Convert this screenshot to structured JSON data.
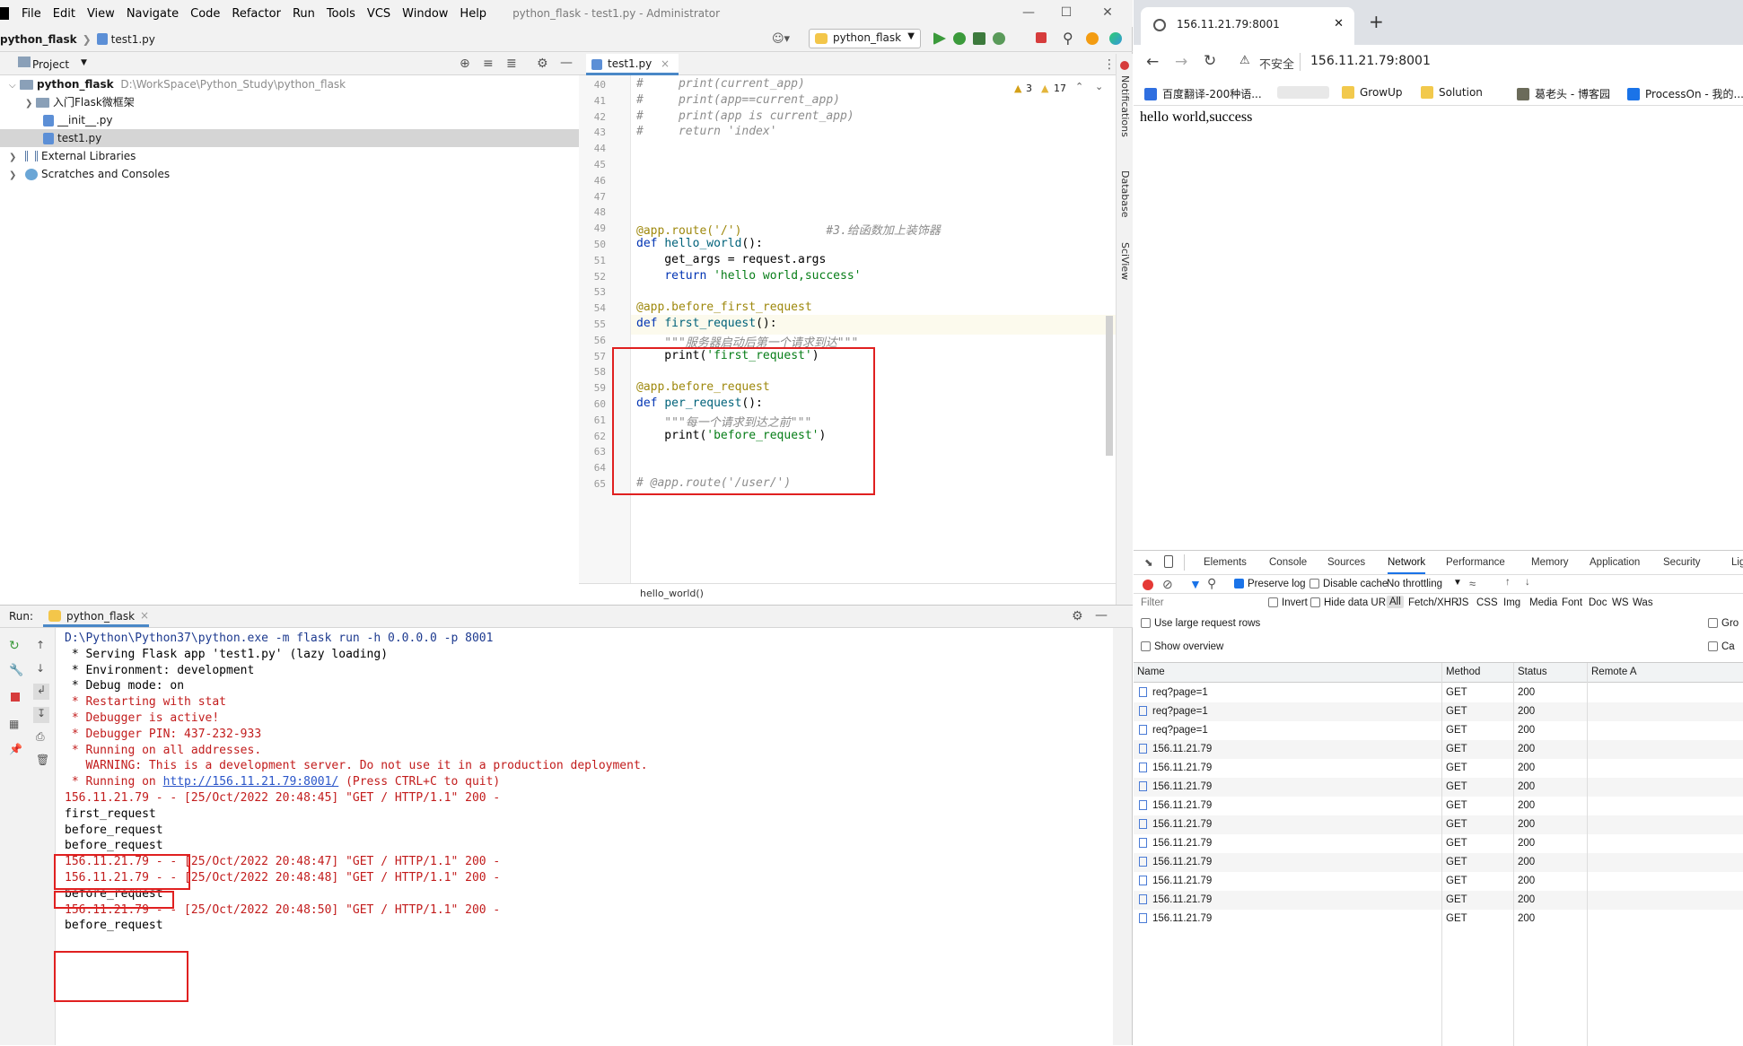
{
  "ide": {
    "menu": [
      "File",
      "Edit",
      "View",
      "Navigate",
      "Code",
      "Refactor",
      "Run",
      "Tools",
      "VCS",
      "Window",
      "Help"
    ],
    "window_title": "python_flask - test1.py - Administrator",
    "breadcrumb": {
      "project": "python_flask",
      "file": "test1.py"
    },
    "run_config": "python_flask",
    "project_panel": {
      "title": "Project",
      "root_name": "python_flask",
      "root_path": "D:\\WorkSpace\\Python_Study\\python_flask",
      "items": [
        {
          "label": "入门Flask微框架",
          "type": "folder"
        },
        {
          "label": "__init__.py",
          "type": "py"
        },
        {
          "label": "test1.py",
          "type": "py"
        },
        {
          "label": "External Libraries",
          "type": "lib"
        },
        {
          "label": "Scratches and Consoles",
          "type": "scratch"
        }
      ]
    },
    "editor": {
      "tab": "test1.py",
      "warnings": "3",
      "weak_warnings": "17",
      "lines": [
        {
          "n": "40",
          "text": "#     print(current_app)"
        },
        {
          "n": "41",
          "text": "#     print(app==current_app)"
        },
        {
          "n": "42",
          "text": "#     print(app is current_app)"
        },
        {
          "n": "43",
          "text": "#     return 'index'"
        },
        {
          "n": "44",
          "text": ""
        },
        {
          "n": "45",
          "text": ""
        },
        {
          "n": "46",
          "text": ""
        },
        {
          "n": "47",
          "text": ""
        },
        {
          "n": "48",
          "text": ""
        },
        {
          "n": "49",
          "text": "@app.route('/')",
          "comment": "#3.给函数加上装饰器"
        },
        {
          "n": "50",
          "text": "def hello_world():"
        },
        {
          "n": "51",
          "text": "    get_args = request.args"
        },
        {
          "n": "52",
          "text": "    return 'hello world,success'"
        },
        {
          "n": "53",
          "text": ""
        },
        {
          "n": "54",
          "text": "@app.before_first_request"
        },
        {
          "n": "55",
          "text": "def first_request():"
        },
        {
          "n": "56",
          "text": "    \"\"\"服务器启动后第一个请求到达\"\"\""
        },
        {
          "n": "57",
          "text": "    print('first_request')"
        },
        {
          "n": "58",
          "text": ""
        },
        {
          "n": "59",
          "text": "@app.before_request"
        },
        {
          "n": "60",
          "text": "def per_request():"
        },
        {
          "n": "61",
          "text": "    \"\"\"每一个请求到达之前\"\"\""
        },
        {
          "n": "62",
          "text": "    print('before_request')"
        },
        {
          "n": "63",
          "text": ""
        },
        {
          "n": "64",
          "text": ""
        },
        {
          "n": "65",
          "text": "# @app.route('/user/')"
        }
      ],
      "status_breadcrumb": "hello_world()"
    },
    "right_strip": [
      "Notifications",
      "Database",
      "SciView"
    ],
    "run_panel": {
      "label": "Run:",
      "tab": "python_flask",
      "lines": [
        {
          "text": "D:\\Python\\Python37\\python.exe -m flask run -h 0.0.0.0 -p 8001",
          "color": "blue"
        },
        {
          "text": " * Serving Flask app 'test1.py' (lazy loading)",
          "color": "black"
        },
        {
          "text": " * Environment: development",
          "color": "black"
        },
        {
          "text": " * Debug mode: on",
          "color": "black"
        },
        {
          "text": " * Restarting with stat",
          "color": "red"
        },
        {
          "text": " * Debugger is active!",
          "color": "red"
        },
        {
          "text": " * Debugger PIN: 437-232-933",
          "color": "red"
        },
        {
          "text": " * Running on all addresses.",
          "color": "red"
        },
        {
          "text": "   WARNING: This is a development server. Do not use it in a production deployment.",
          "color": "red"
        },
        {
          "text": " * Running on ",
          "link": "http://156.11.21.79:8001/",
          "after": " (Press CTRL+C to quit)",
          "color": "red"
        },
        {
          "text": "156.11.21.79 - - [25/Oct/2022 20:48:45] \"GET / HTTP/1.1\" 200 -",
          "color": "red"
        },
        {
          "text": "first_request",
          "color": "black"
        },
        {
          "text": "before_request",
          "color": "black"
        },
        {
          "text": "before_request",
          "color": "black"
        },
        {
          "text": "156.11.21.79 - - [25/Oct/2022 20:48:47] \"GET / HTTP/1.1\" 200 -",
          "color": "red"
        },
        {
          "text": "156.11.21.79 - - [25/Oct/2022 20:48:48] \"GET / HTTP/1.1\" 200 -",
          "color": "red"
        },
        {
          "text": "before_request",
          "color": "black"
        },
        {
          "text": "156.11.21.79 - - [25/Oct/2022 20:48:50] \"GET / HTTP/1.1\" 200 -",
          "color": "red"
        },
        {
          "text": "before_request",
          "color": "black"
        }
      ]
    }
  },
  "browser": {
    "tab_title": "156.11.21.79:8001",
    "insecure_label": "不安全",
    "url": "156.11.21.79:8001",
    "bookmarks": [
      "百度翻译-200种语...",
      "GrowUp",
      "Solution",
      "葛老头 - 博客园",
      "ProcessOn - 我的..."
    ],
    "page_text": "hello world,success",
    "devtools": {
      "tabs": [
        "Elements",
        "Console",
        "Sources",
        "Network",
        "Performance",
        "Memory",
        "Application",
        "Security",
        "Lig"
      ],
      "active_tab": "Network",
      "preserve_log": "Preserve log",
      "disable_cache": "Disable cache",
      "throttling": "No throttling",
      "filter_placeholder": "Filter",
      "invert": "Invert",
      "hide_data_urls": "Hide data URLs",
      "type_filters": [
        "All",
        "Fetch/XHR",
        "JS",
        "CSS",
        "Img",
        "Media",
        "Font",
        "Doc",
        "WS",
        "Was"
      ],
      "use_large_rows": "Use large request rows",
      "show_overview": "Show overview",
      "group_partial": "Gro",
      "capture_partial": "Ca",
      "columns": [
        "Name",
        "Method",
        "Status",
        "Remote A"
      ],
      "rows": [
        {
          "name": "req?page=1",
          "method": "GET",
          "status": "200"
        },
        {
          "name": "req?page=1",
          "method": "GET",
          "status": "200"
        },
        {
          "name": "req?page=1",
          "method": "GET",
          "status": "200"
        },
        {
          "name": "156.11.21.79",
          "method": "GET",
          "status": "200"
        },
        {
          "name": "156.11.21.79",
          "method": "GET",
          "status": "200"
        },
        {
          "name": "156.11.21.79",
          "method": "GET",
          "status": "200"
        },
        {
          "name": "156.11.21.79",
          "method": "GET",
          "status": "200"
        },
        {
          "name": "156.11.21.79",
          "method": "GET",
          "status": "200"
        },
        {
          "name": "156.11.21.79",
          "method": "GET",
          "status": "200"
        },
        {
          "name": "156.11.21.79",
          "method": "GET",
          "status": "200"
        },
        {
          "name": "156.11.21.79",
          "method": "GET",
          "status": "200"
        },
        {
          "name": "156.11.21.79",
          "method": "GET",
          "status": "200"
        },
        {
          "name": "156.11.21.79",
          "method": "GET",
          "status": "200"
        }
      ]
    }
  }
}
